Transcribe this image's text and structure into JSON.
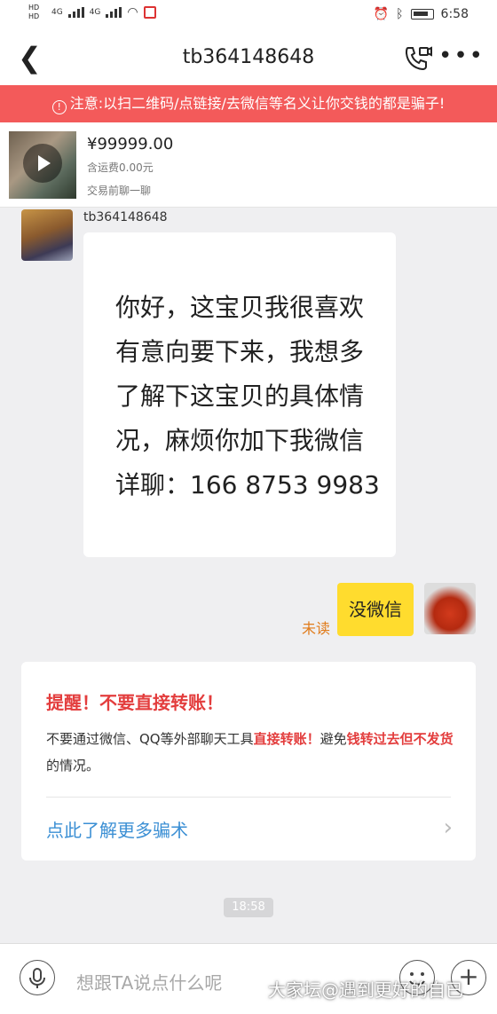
{
  "status_bar": {
    "network": "4G",
    "network2": "4G",
    "sim1": "HD",
    "sim2": "HD",
    "time": "6:58"
  },
  "nav": {
    "title": "tb364148648"
  },
  "warning": {
    "text": "注意:以扫二维码/点链接/去微信等名义让你交钱的都是骗子!"
  },
  "product": {
    "price": "¥99999.00",
    "shipping": "含运费0.00元",
    "chat_hint": "交易前聊一聊"
  },
  "messages": {
    "incoming": {
      "sender": "tb364148648",
      "image_text": "你好，这宝贝我很喜欢有意向要下来，我想多了解下这宝贝的具体情况，麻烦你加下我微信详聊：166 8753 9983"
    },
    "outgoing": {
      "text": "没微信",
      "status": "未读"
    }
  },
  "notice": {
    "title": "提醒！不要直接转账！",
    "body_1": "不要通过微信、QQ等外部聊天工具",
    "body_red_1": "直接转账！",
    "body_2": "避免",
    "body_red_2": "钱转过去但不发货",
    "body_3": "的情况。",
    "link": "点此了解更多骗术"
  },
  "timestamp": "18:58",
  "input": {
    "placeholder": "想跟TA说点什么呢"
  },
  "watermark": "大家坛@遇到更好的自已",
  "colors": {
    "warning_bg": "#f35a5a",
    "outgoing_bubble": "#ffdc2e",
    "alert_red": "#e33d3d",
    "link_blue": "#3b8fd4",
    "unread_orange": "#e07b1a"
  }
}
